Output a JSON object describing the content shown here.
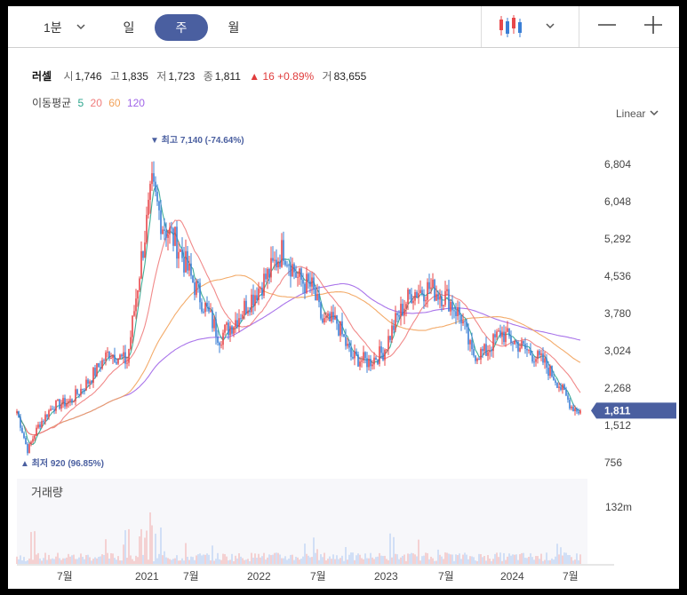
{
  "toolbar": {
    "interval_label": "1분",
    "interval_chevron": "⌄",
    "day_label": "일",
    "week_label": "주",
    "month_label": "월",
    "chart_type_icon": "candlestick-icon",
    "minus_label": "—",
    "plus_label": "+"
  },
  "quote": {
    "name": "러셀",
    "open_label": "시",
    "open": "1,746",
    "high_label": "고",
    "high": "1,835",
    "low_label": "저",
    "low": "1,723",
    "close_label": "종",
    "close": "1,811",
    "change": "▲ 16 +0.89%",
    "volume_label": "거",
    "volume": "83,655"
  },
  "ma_legend": {
    "label": "이동평균",
    "p5": "5",
    "p20": "20",
    "p60": "60",
    "p120": "120"
  },
  "scale_mode": "Linear",
  "colors": {
    "up": "#e8474a",
    "down": "#3b7fd6",
    "ma5": "#2ca58d",
    "ma20": "#f07c7c",
    "ma60": "#f2a25a",
    "ma120": "#a065e8",
    "accent": "#4a5fa0"
  },
  "chart_data": {
    "type": "candlestick",
    "price_ticks": [
      "6,804",
      "6,048",
      "5,292",
      "4,536",
      "3,780",
      "3,024",
      "2,268",
      "1,512",
      "756"
    ],
    "current_price": "1,811",
    "high_label": "▼ 최고 7,140 (-74.64%)",
    "low_label": "▲ 최저 920 (96.85%)",
    "time_ticks": [
      "7월",
      "2021",
      "7월",
      "2022",
      "7월",
      "2023",
      "7월",
      "2024",
      "7월"
    ],
    "volume_label": "거래량",
    "volume_tick": "132m",
    "ylim": [
      756,
      7200
    ],
    "key_points": [
      {
        "t": 0,
        "v": 1800
      },
      {
        "t": 6,
        "v": 1000
      },
      {
        "t": 12,
        "v": 1500
      },
      {
        "t": 20,
        "v": 1900
      },
      {
        "t": 30,
        "v": 2000
      },
      {
        "t": 40,
        "v": 2400
      },
      {
        "t": 52,
        "v": 3000
      },
      {
        "t": 62,
        "v": 2800
      },
      {
        "t": 70,
        "v": 4900
      },
      {
        "t": 76,
        "v": 6300
      },
      {
        "t": 82,
        "v": 5600
      },
      {
        "t": 90,
        "v": 5200
      },
      {
        "t": 98,
        "v": 4500
      },
      {
        "t": 106,
        "v": 3900
      },
      {
        "t": 114,
        "v": 3300
      },
      {
        "t": 122,
        "v": 3600
      },
      {
        "t": 132,
        "v": 4100
      },
      {
        "t": 142,
        "v": 4600
      },
      {
        "t": 150,
        "v": 5100
      },
      {
        "t": 158,
        "v": 4500
      },
      {
        "t": 166,
        "v": 4300
      },
      {
        "t": 172,
        "v": 3600
      },
      {
        "t": 180,
        "v": 3600
      },
      {
        "t": 188,
        "v": 2900
      },
      {
        "t": 198,
        "v": 2800
      },
      {
        "t": 206,
        "v": 3000
      },
      {
        "t": 214,
        "v": 3700
      },
      {
        "t": 222,
        "v": 4200
      },
      {
        "t": 232,
        "v": 4300
      },
      {
        "t": 242,
        "v": 4100
      },
      {
        "t": 250,
        "v": 3700
      },
      {
        "t": 256,
        "v": 2950
      },
      {
        "t": 264,
        "v": 3000
      },
      {
        "t": 272,
        "v": 3400
      },
      {
        "t": 280,
        "v": 3200
      },
      {
        "t": 288,
        "v": 3000
      },
      {
        "t": 296,
        "v": 2800
      },
      {
        "t": 304,
        "v": 2400
      },
      {
        "t": 312,
        "v": 1900
      },
      {
        "t": 316,
        "v": 1811
      }
    ]
  }
}
